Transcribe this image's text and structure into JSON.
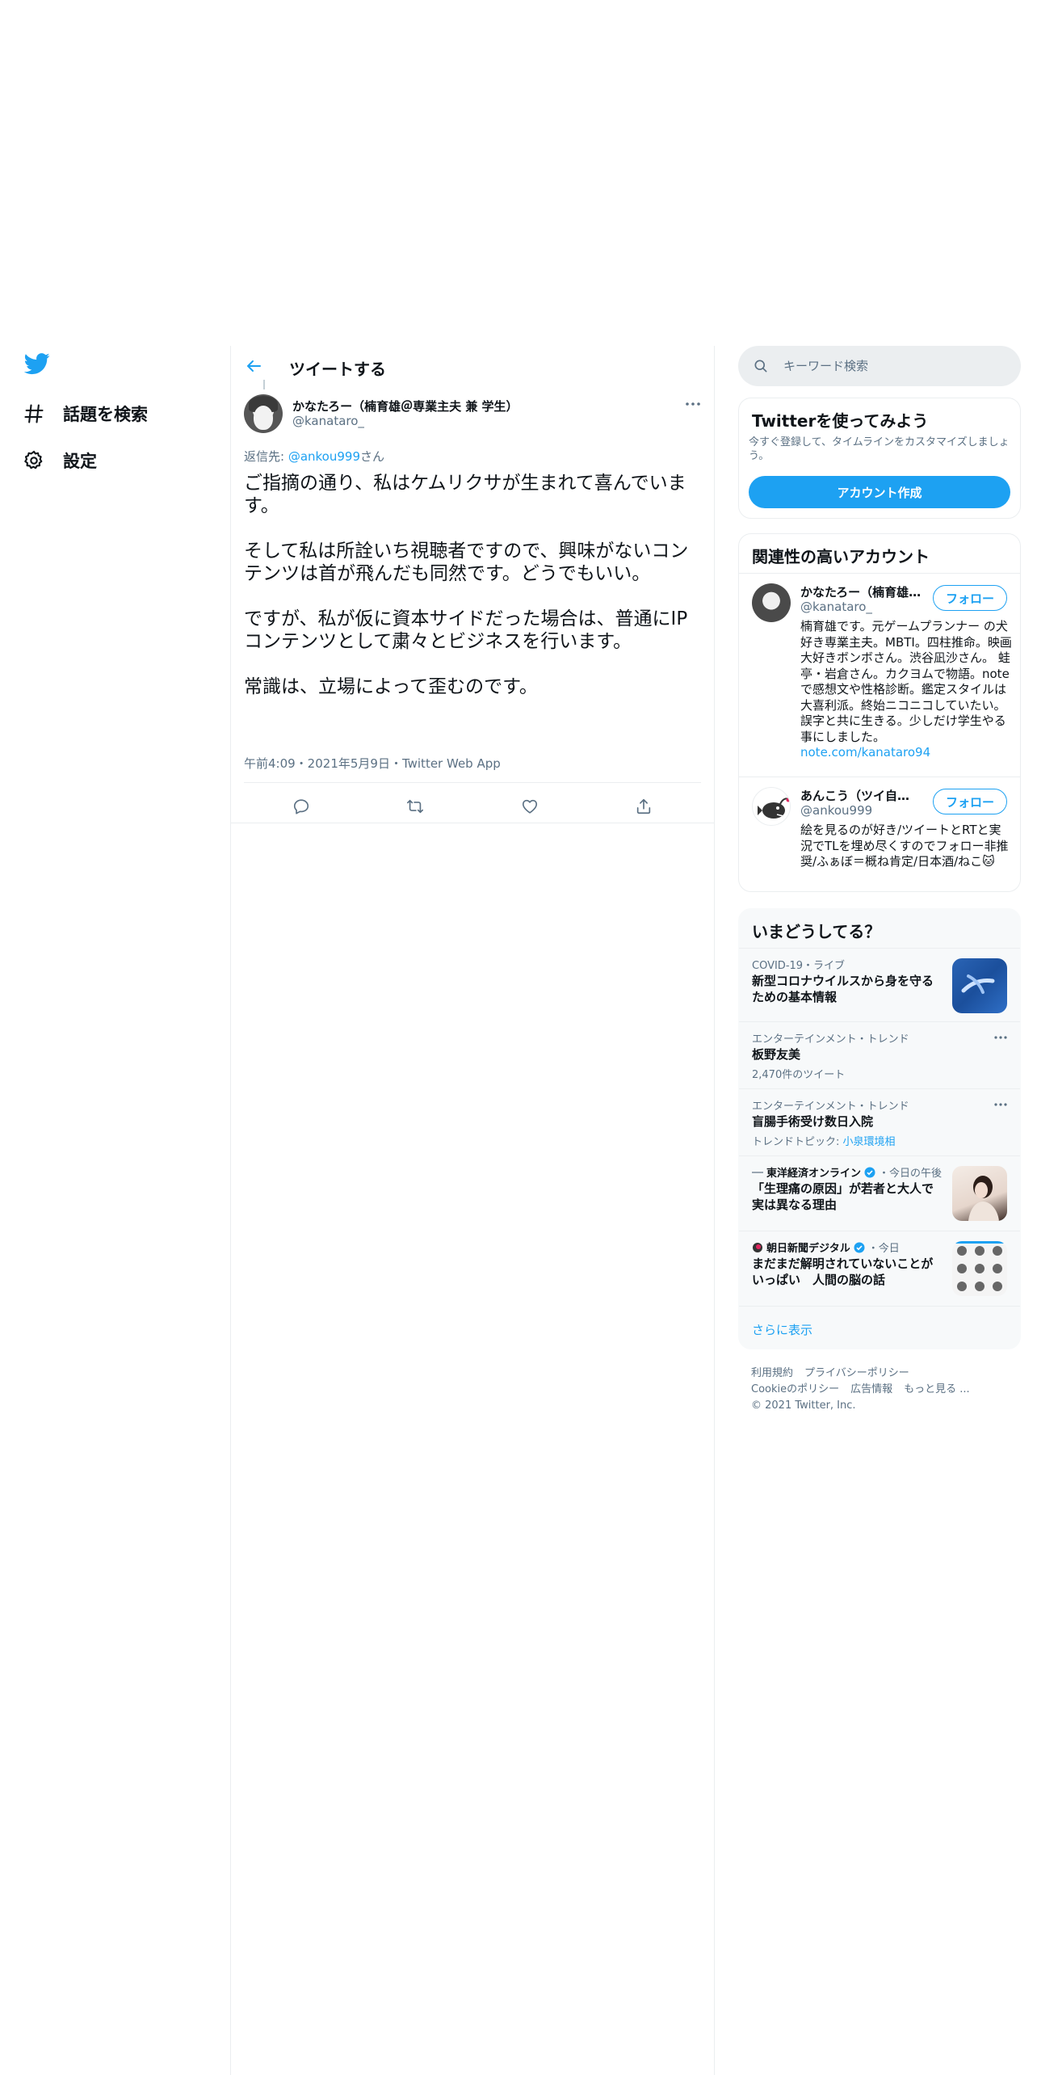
{
  "nav": {
    "explore_label": "話題を検索",
    "settings_label": "設定"
  },
  "header": {
    "title": "ツイートする"
  },
  "tweet": {
    "author_name": "かなたろー（楠育雄＠専業主夫 兼 学生）",
    "author_handle": "@kanataro_",
    "reply_prefix": "返信先: ",
    "reply_handle": "@ankou999",
    "reply_suffix": "さん",
    "text": "ご指摘の通り、私はケムリクサが生まれて喜んでいます。\n\nそして私は所詮いち視聴者ですので、興味がないコンテンツは首が飛んだも同然です。どうでもいい。\n\nですが、私が仮に資本サイドだった場合は、普通にIPコンテンツとして粛々とビジネスを行います。\n\n常識は、立場によって歪むのです。",
    "meta": "午前4:09・2021年5月9日・Twitter Web App"
  },
  "search": {
    "placeholder": "キーワード検索"
  },
  "signup": {
    "title": "Twitterを使ってみよう",
    "description": "今すぐ登録して、タイムラインをカスタマイズしましょう。",
    "button_label": "アカウント作成"
  },
  "related": {
    "title": "関連性の高いアカウント",
    "accounts": [
      {
        "name": "かなたろー（楠育雄＠専業主夫 兼 学生）",
        "handle": "@kanataro_",
        "bio": "楠育雄です。元ゲームプランナー の犬好き専業主夫。MBTI。四柱推命。映画大好きボンボさん。渋谷凪沙さん。 蛙亭・岩倉さん。カクヨムで物語。noteで感想文や性格診断。鑑定スタイルは大喜利派。終始ニコニコしていたい。誤字と共に生きる。少しだけ学生やる事にしました。",
        "bio_link": "note.com/kanataro94",
        "follow_label": "フォロー"
      },
      {
        "name": "あんこう（ツイ自重中）",
        "handle": "@ankou999",
        "bio": "絵を見るのが好き/ツイートとRTと実況でTLを埋め尽くすのでフォロー非推奨/ふぁぼ＝概ね肯定/日本酒/ねこ🐱",
        "follow_label": "フォロー"
      }
    ]
  },
  "trends": {
    "title": "いまどうしてる？",
    "items": [
      {
        "meta": "COVID-19・ライブ",
        "headline": "新型コロナウイルスから身を守るための基本情報"
      },
      {
        "meta": "エンターテインメント・トレンド",
        "headline": "板野友美",
        "sub": "2,470件のツイート"
      },
      {
        "meta": "エンターテインメント・トレンド",
        "headline": "盲腸手術受け数日入院",
        "sub_prefix": "トレンドトピック: ",
        "sub_link": "小泉環境相"
      },
      {
        "source": "東洋経済オンライン",
        "time": "・今日の午後",
        "headline": "「生理痛の原因」が若者と大人で実は異なる理由"
      },
      {
        "source": "朝日新聞デジタル",
        "time": "・今日",
        "headline": "まだまだ解明されていないことがいっぱい　人間の脳の話"
      }
    ],
    "show_more": "さらに表示"
  },
  "footer": {
    "links": [
      "利用規約",
      "プライバシーポリシー",
      "Cookieのポリシー",
      "広告情報",
      "もっと見る ..."
    ],
    "copyright": "© 2021 Twitter, Inc."
  },
  "colors": {
    "accent": "#1da1f2",
    "secondary_text": "#5b7083",
    "border": "#ebeef0",
    "panel": "#f7f9fa"
  }
}
